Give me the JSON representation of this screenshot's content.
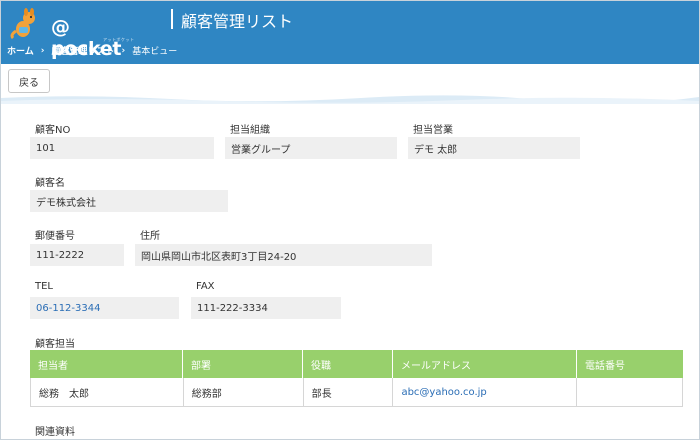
{
  "header": {
    "logo_text": "@ pocket",
    "logo_sub": "アットポケット",
    "page_title": "顧客管理リスト"
  },
  "breadcrumb": [
    "ホーム",
    "顧客管理リスト",
    "基本ビュー"
  ],
  "toolbar": {
    "back_label": "戻る"
  },
  "form": {
    "customer_no": {
      "label": "顧客NO",
      "value": "101"
    },
    "org": {
      "label": "担当組織",
      "value": "営業グループ"
    },
    "sales_rep": {
      "label": "担当営業",
      "value": "デモ 太郎"
    },
    "customer_name": {
      "label": "顧客名",
      "value": "デモ株式会社"
    },
    "postal_code": {
      "label": "郵便番号",
      "value": "111-2222"
    },
    "address": {
      "label": "住所",
      "value": "岡山県岡山市北区表町3丁目24-20"
    },
    "tel": {
      "label": "TEL",
      "value": "06-112-3344"
    },
    "fax": {
      "label": "FAX",
      "value": "111-222-3334"
    }
  },
  "contacts": {
    "label": "顧客担当",
    "columns": [
      "担当者",
      "部署",
      "役職",
      "メールアドレス",
      "電話番号"
    ],
    "rows": [
      {
        "name": "総務　太郎",
        "dept": "総務部",
        "title": "部長",
        "email": "abc@yahoo.co.jp",
        "phone": ""
      }
    ]
  },
  "related": {
    "label": "関連資料"
  },
  "colors": {
    "header_bg": "#2f86c3",
    "table_header_bg": "#98d06c",
    "link": "#2a6db5",
    "field_bg": "#efefef"
  }
}
